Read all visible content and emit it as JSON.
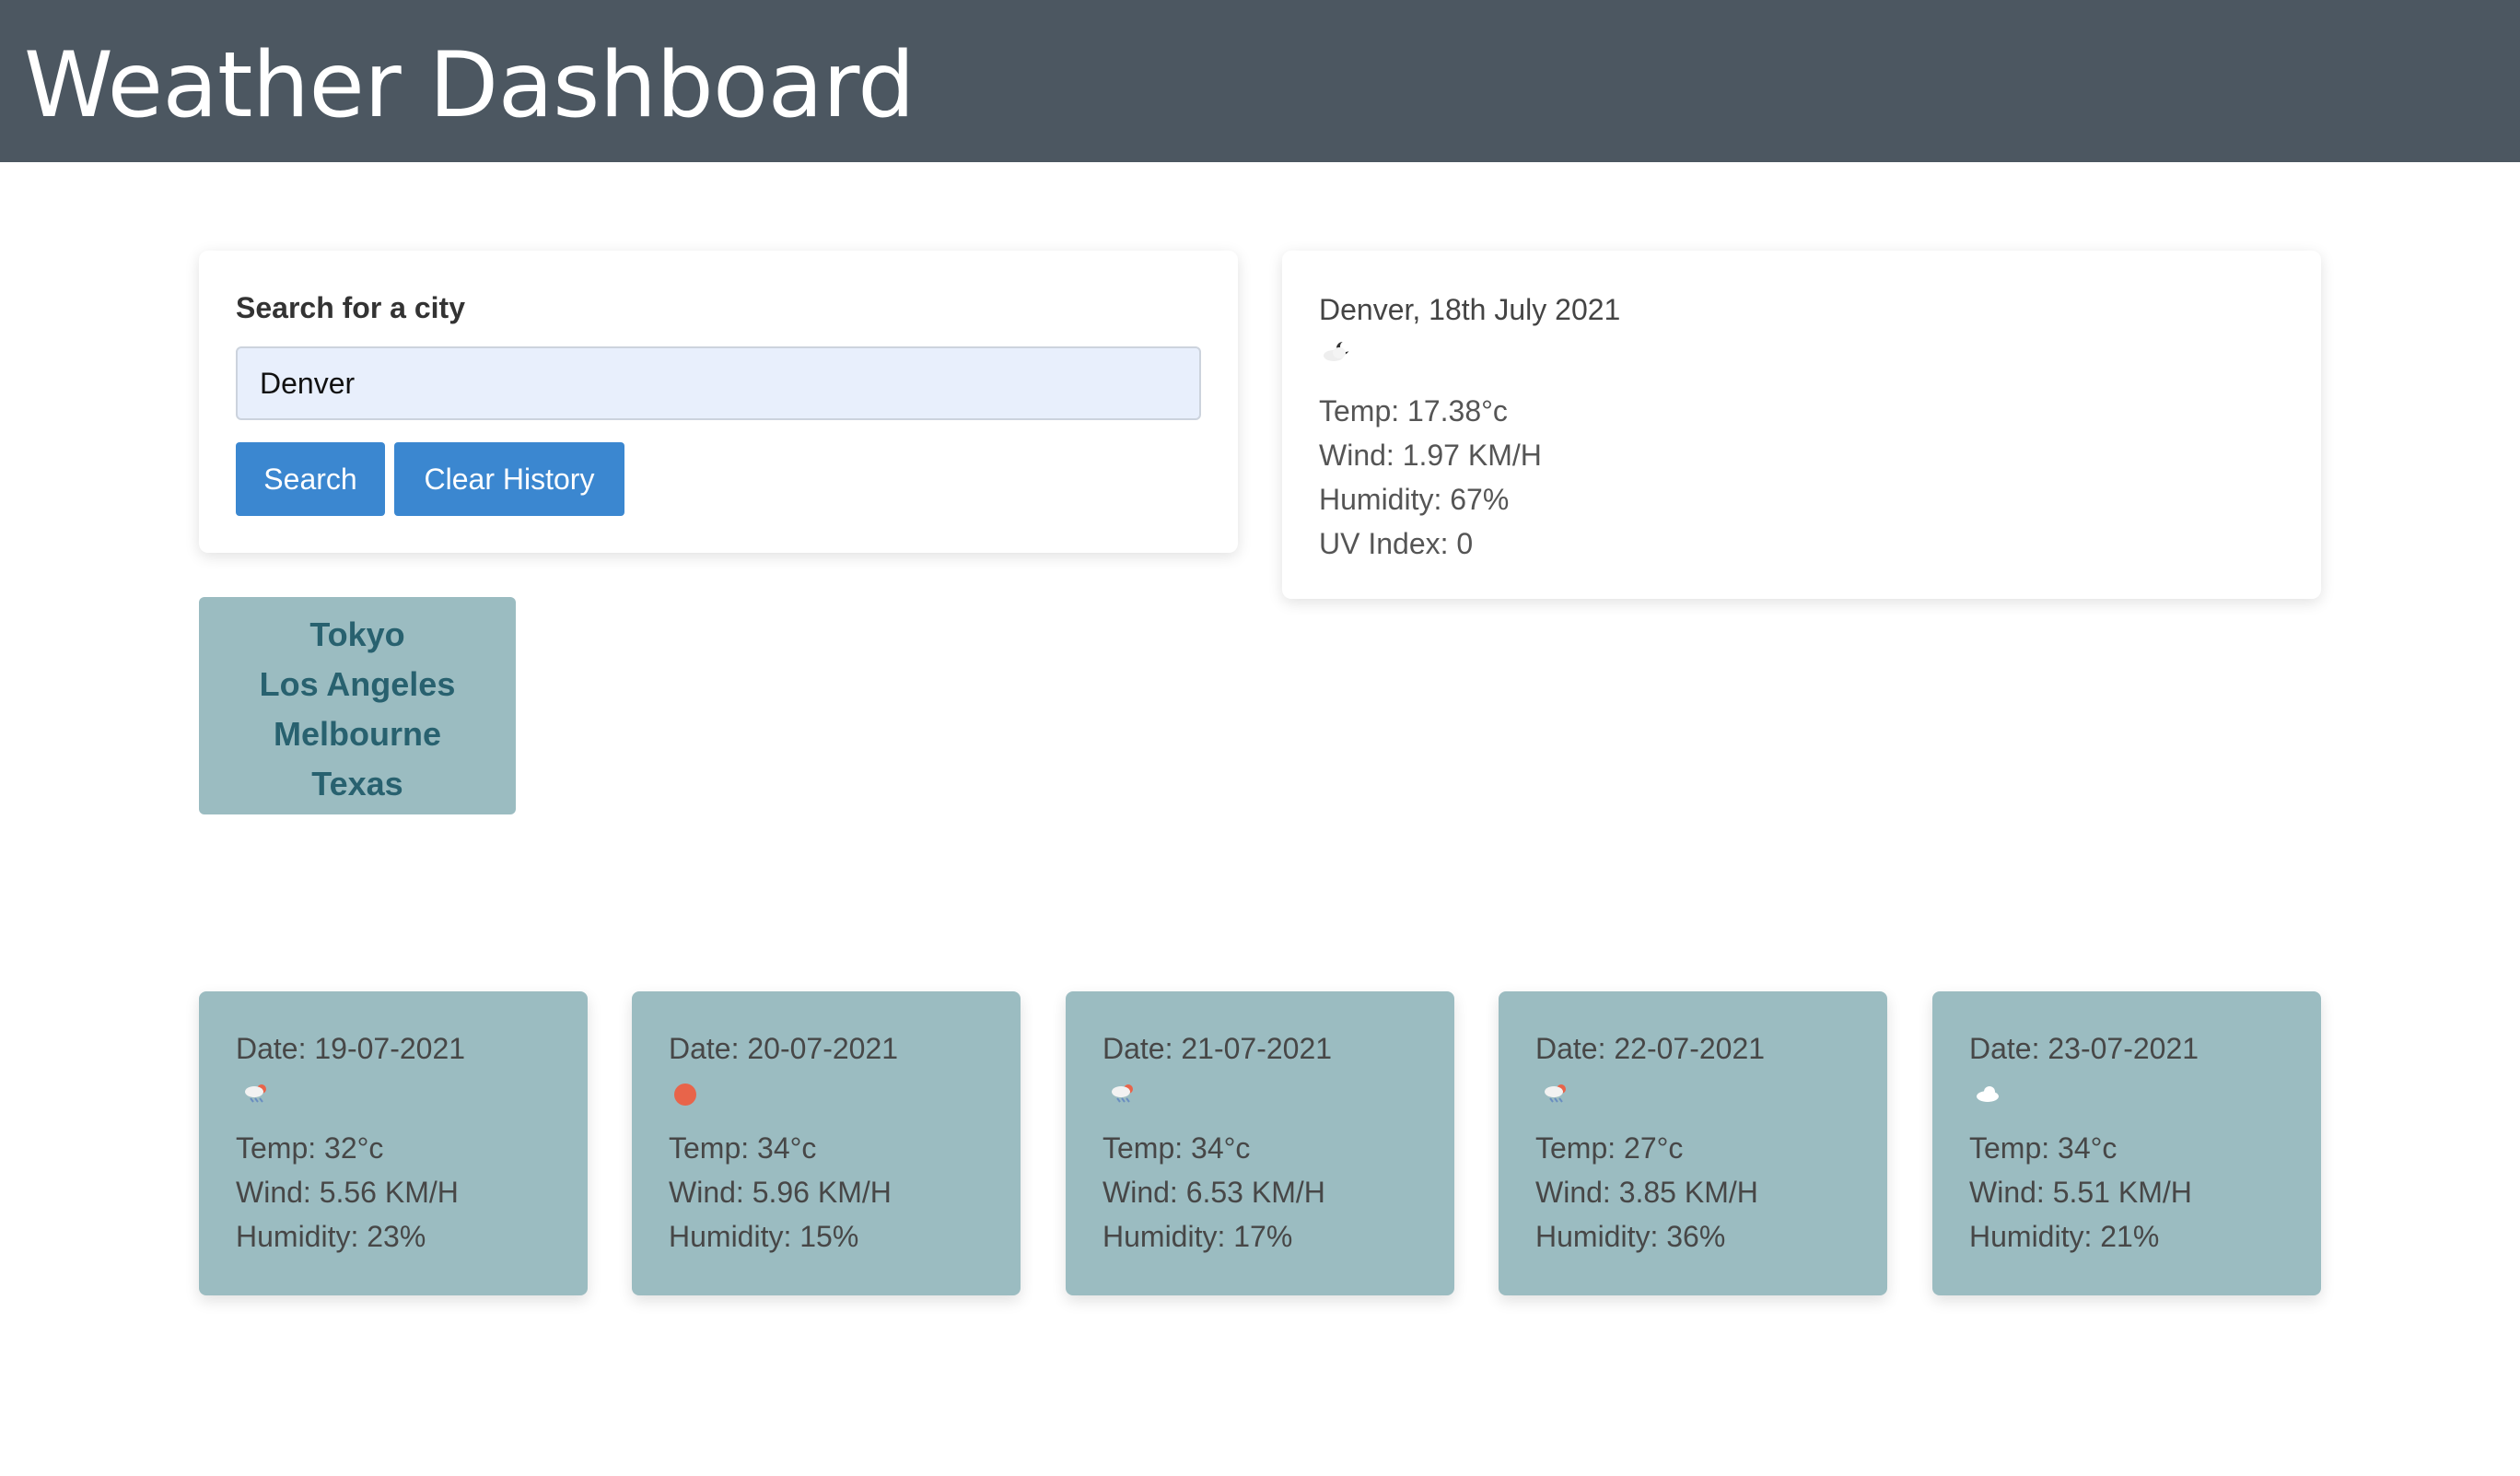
{
  "header": {
    "title": "Weather Dashboard"
  },
  "search": {
    "label": "Search for a city",
    "value": "Denver",
    "search_label": "Search",
    "clear_label": "Clear History"
  },
  "current": {
    "title": "Denver, 18th July 2021",
    "icon": "partly-cloudy-night-icon",
    "temp": "Temp: 17.38°c",
    "wind": "Wind: 1.97 KM/H",
    "humidity": "Humidity: 67%",
    "uv": "UV Index: 0"
  },
  "history": [
    "Tokyo",
    "Los Angeles",
    "Melbourne",
    "Texas"
  ],
  "forecast": [
    {
      "date": "Date: 19-07-2021",
      "icon": "thunderstorm-icon",
      "temp": "Temp: 32°c",
      "wind": "Wind: 5.56 KM/H",
      "humidity": "Humidity: 23%"
    },
    {
      "date": "Date: 20-07-2021",
      "icon": "sun-icon",
      "temp": "Temp: 34°c",
      "wind": "Wind: 5.96 KM/H",
      "humidity": "Humidity: 15%"
    },
    {
      "date": "Date: 21-07-2021",
      "icon": "thunderstorm-icon",
      "temp": "Temp: 34°c",
      "wind": "Wind: 6.53 KM/H",
      "humidity": "Humidity: 17%"
    },
    {
      "date": "Date: 22-07-2021",
      "icon": "thunderstorm-icon",
      "temp": "Temp: 27°c",
      "wind": "Wind: 3.85 KM/H",
      "humidity": "Humidity: 36%"
    },
    {
      "date": "Date: 23-07-2021",
      "icon": "cloud-icon",
      "temp": "Temp: 34°c",
      "wind": "Wind: 5.51 KM/H",
      "humidity": "Humidity: 21%"
    }
  ],
  "colors": {
    "header_bg": "#4c5761",
    "accent": "#3b87d0",
    "card_teal": "#9bbcc1",
    "history_text": "#28616f"
  }
}
